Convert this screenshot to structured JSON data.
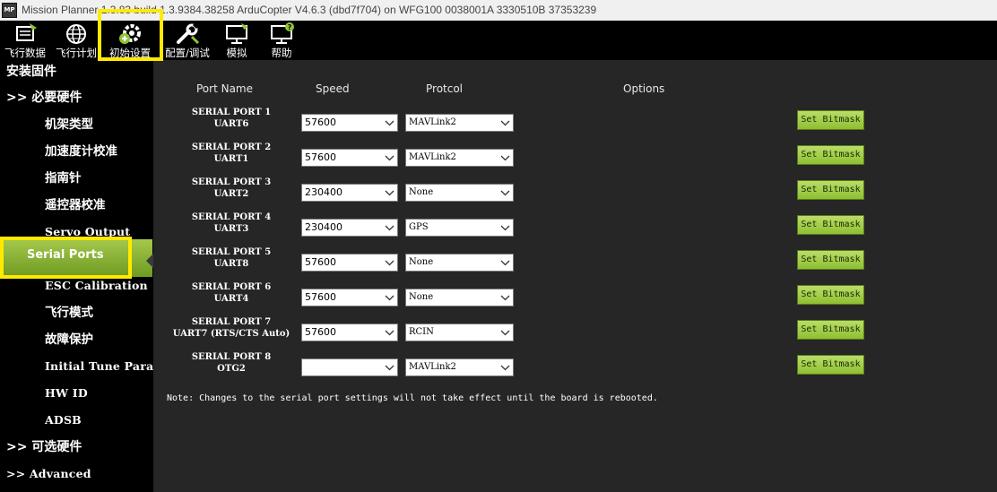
{
  "window": {
    "title": "Mission Planner 1.3.83 build 1.3.9384.38258 ArduCopter V4.6.3 (dbd7f704) on WFG100 0038001A 3330510B 37353239",
    "app_icon_text": "MP"
  },
  "toolbar": {
    "items": [
      {
        "label": "飞行数据",
        "icon": "flight-data-icon"
      },
      {
        "label": "飞行计划",
        "icon": "flight-plan-globe-icon"
      },
      {
        "label": "初始设置",
        "icon": "initial-setup-icon"
      },
      {
        "label": "配置/调试",
        "icon": "config-tuning-icon"
      },
      {
        "label": "模拟",
        "icon": "simulation-icon"
      },
      {
        "label": "帮助",
        "icon": "help-icon"
      }
    ]
  },
  "sidebar": {
    "header": "安装固件",
    "items": [
      {
        "label": ">> 必要硬件"
      },
      {
        "label": "机架类型"
      },
      {
        "label": "加速度计校准"
      },
      {
        "label": "指南针"
      },
      {
        "label": "遥控器校准"
      },
      {
        "label": "Servo Output"
      },
      {
        "label": "Serial Ports"
      },
      {
        "label": "ESC Calibration"
      },
      {
        "label": "飞行模式"
      },
      {
        "label": "故障保护"
      },
      {
        "label": "Initial Tune Parameters"
      },
      {
        "label": "HW ID"
      },
      {
        "label": "ADSB"
      },
      {
        "label": ">> 可选硬件"
      },
      {
        "label": ">> Advanced"
      }
    ],
    "selected_color": "#8fb83a"
  },
  "main": {
    "headers": {
      "port_name": "Port Name",
      "speed": "Speed",
      "protocol": "Protcol",
      "options": "Options"
    },
    "rows": [
      {
        "name": "SERIAL PORT 1",
        "uart": "UART6",
        "speed": "57600",
        "protocol": "MAVLink2",
        "button": "Set Bitmask"
      },
      {
        "name": "SERIAL PORT 2",
        "uart": "UART1",
        "speed": "57600",
        "protocol": "MAVLink2",
        "button": "Set Bitmask"
      },
      {
        "name": "SERIAL PORT 3",
        "uart": "UART2",
        "speed": "230400",
        "protocol": "None",
        "button": "Set Bitmask"
      },
      {
        "name": "SERIAL PORT 4",
        "uart": "UART3",
        "speed": "230400",
        "protocol": "GPS",
        "button": "Set Bitmask"
      },
      {
        "name": "SERIAL PORT 5",
        "uart": "UART8",
        "speed": "57600",
        "protocol": "None",
        "button": "Set Bitmask"
      },
      {
        "name": "SERIAL PORT 6",
        "uart": "UART4",
        "speed": "57600",
        "protocol": "None",
        "button": "Set Bitmask"
      },
      {
        "name": "SERIAL PORT 7",
        "uart": "UART7 (RTS/CTS Auto)",
        "speed": "57600",
        "protocol": "RCIN",
        "button": "Set Bitmask"
      },
      {
        "name": "SERIAL PORT 8",
        "uart": "OTG2",
        "speed": "",
        "protocol": "MAVLink2",
        "button": "Set Bitmask"
      }
    ],
    "note": "Note: Changes to the serial port settings will not take effect until the board is rebooted."
  },
  "colors": {
    "highlight": "#ffea00",
    "button_green": "#a6cf4e",
    "background": "#262626"
  }
}
